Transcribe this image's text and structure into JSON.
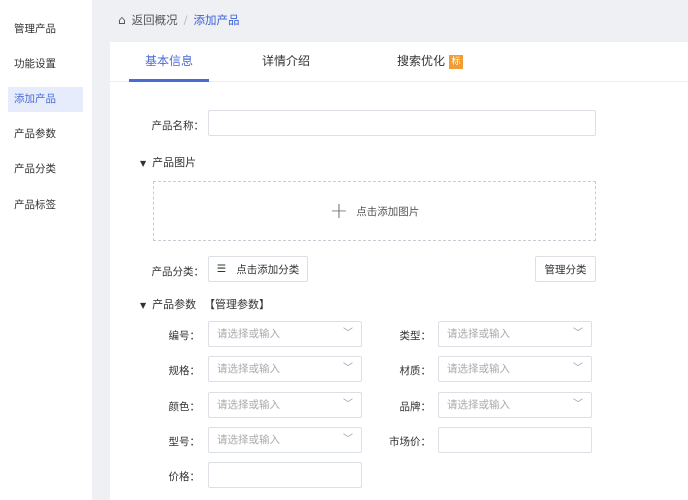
{
  "sidebar": {
    "items": [
      {
        "label": "管理产品"
      },
      {
        "label": "功能设置"
      },
      {
        "label": "添加产品"
      },
      {
        "label": "产品参数"
      },
      {
        "label": "产品分类"
      },
      {
        "label": "产品标签"
      }
    ]
  },
  "breadcrumb": {
    "back": "返回概况",
    "sep": "/",
    "current": "添加产品"
  },
  "tabs": [
    {
      "label": "基本信息"
    },
    {
      "label": "详情介绍"
    },
    {
      "label": "搜索优化"
    }
  ],
  "tab_badge": "标",
  "form": {
    "name_label": "产品名称：",
    "name_value": "",
    "images_section": "产品图片",
    "upload_label": "点击添加图片",
    "category_label": "产品分类：",
    "category_button": "点击添加分类",
    "manage_category": "管理分类",
    "params_section": "产品参数",
    "manage_params": "【管理参数】",
    "placeholder": "请选择或输入",
    "fields": {
      "code": "编号：",
      "type": "类型：",
      "spec": "规格：",
      "material": "材质：",
      "color": "颜色：",
      "brand": "品牌：",
      "model": "型号：",
      "market_price": "市场价：",
      "price": "价格："
    }
  }
}
